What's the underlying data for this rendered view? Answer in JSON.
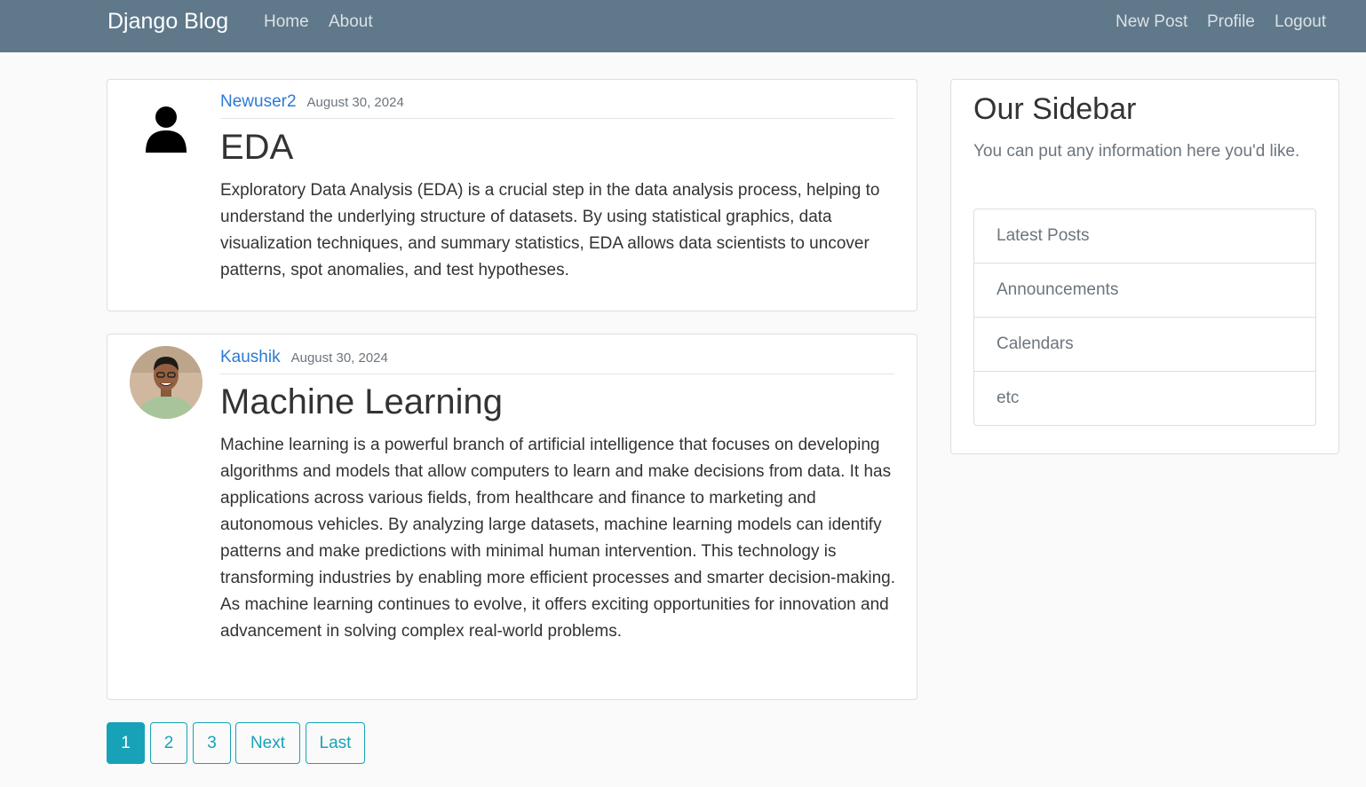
{
  "navbar": {
    "brand": "Django Blog",
    "left_links": [
      "Home",
      "About"
    ],
    "right_links": [
      "New Post",
      "Profile",
      "Logout"
    ]
  },
  "posts": [
    {
      "author": "Newuser2",
      "date": "August 30, 2024",
      "title": "EDA",
      "avatar": "default-user-icon",
      "content": "Exploratory Data Analysis (EDA) is a crucial step in the data analysis process, helping to understand the underlying structure of datasets. By using statistical graphics, data visualization techniques, and summary statistics, EDA allows data scientists to uncover patterns, spot anomalies, and test hypotheses."
    },
    {
      "author": "Kaushik",
      "date": "August 30, 2024",
      "title": "Machine Learning",
      "avatar": "profile-photo",
      "content": "Machine learning is a powerful branch of artificial intelligence that focuses on developing algorithms and models that allow computers to learn and make decisions from data. It has applications across various fields, from healthcare and finance to marketing and autonomous vehicles. By analyzing large datasets, machine learning models can identify patterns and make predictions with minimal human intervention. This technology is transforming industries by enabling more efficient processes and smarter decision-making. As machine learning continues to evolve, it offers exciting opportunities for innovation and advancement in solving complex real-world problems."
    }
  ],
  "sidebar": {
    "title": "Our Sidebar",
    "description": "You can put any information here you'd like.",
    "items": [
      "Latest Posts",
      "Announcements",
      "Calendars",
      "etc"
    ]
  },
  "pagination": {
    "current_page": "1",
    "pages": [
      "1",
      "2",
      "3"
    ],
    "next_label": "Next",
    "last_label": "Last"
  },
  "colors": {
    "navbar": "#5f788a",
    "link": "#2a7ad6",
    "accent": "#17a2b8"
  }
}
